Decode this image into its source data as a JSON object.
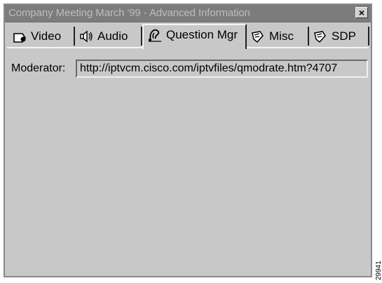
{
  "window": {
    "title": "Company Meeting March '99 - Advanced Information",
    "close_label": "×"
  },
  "tabs": [
    {
      "label": "Video",
      "icon": "video-icon"
    },
    {
      "label": "Audio",
      "icon": "speaker-icon"
    },
    {
      "label": "Question Mgr",
      "icon": "question-mgr-icon"
    },
    {
      "label": "Misc",
      "icon": "misc-icon"
    },
    {
      "label": "SDP",
      "icon": "sdp-icon"
    }
  ],
  "active_tab": "Question Mgr",
  "panel": {
    "moderator_label": "Moderator:",
    "moderator_value": "http://iptvcm.cisco.com/iptvfiles/qmodrate.htm?4707"
  },
  "watermark": "29941"
}
